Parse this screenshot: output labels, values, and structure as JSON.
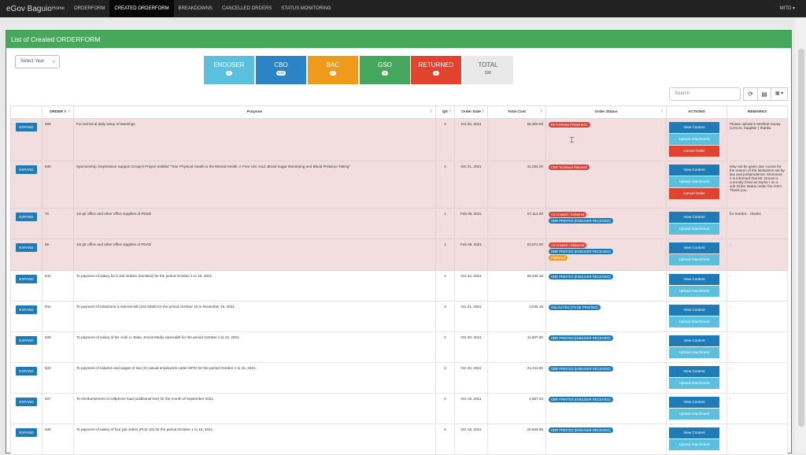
{
  "nav": {
    "brand": "eGov Baguio",
    "items": [
      "Home",
      "ORDERFORM",
      "CREATED ORDERFORM",
      "BREAKDOWNS",
      "CANCELLED ORDERS",
      "STATUS MONITORING"
    ],
    "user": "MITD ▾"
  },
  "panel": {
    "title": "List of Created ORDERFORM"
  },
  "year_select": "Select Year",
  "stats": {
    "enduser": {
      "label": "ENDUSER",
      "count": "0"
    },
    "cbo": {
      "label": "CBO",
      "count": "540"
    },
    "bac": {
      "label": "BAC",
      "count": "1"
    },
    "gso": {
      "label": "GSO",
      "count": "4"
    },
    "returned": {
      "label": "RETURNED",
      "count": "1"
    },
    "total": {
      "label": "TOTAL",
      "count": "596"
    }
  },
  "toolbar": {
    "search_placeholder": "Search",
    "refresh": "⟳",
    "list": "▤",
    "columns": "▦ ▾"
  },
  "table": {
    "headers": [
      "",
      "ORDER #",
      "Purpose",
      "Qtr",
      "Order Date",
      "Total Cost",
      "Order Status",
      "ACTIONS",
      "REMARKS"
    ],
    "expand_label": "EXPAND",
    "view_label": "View Content",
    "upload_label": "Upload Attachment",
    "cancel_label": "Cancel Order",
    "rows": [
      {
        "order": "599",
        "purpose": "For technical daily setup of Meetings",
        "qtr": "4",
        "date": "Oct 05, 2021",
        "cost": "66,300.00",
        "statuses": [
          {
            "text": "RETURNED FROM BAC",
            "color": "red"
          }
        ],
        "remarks": "Please upload 2 MARket Suvey (LOCAL Supplier ) thanks.",
        "cancel": true
      },
      {
        "order": "640",
        "purpose": "Sponsorship: Depression Support Group's Project entitled \"Your Physical Health is the Mental Health: A Free Uric Acid, Blood Sugar Monitoring and Blood Pressure Taking\"",
        "qtr": "4",
        "date": "Oct 21, 2021",
        "cost": "41,034.00",
        "statuses": [
          {
            "text": "CBO Technical Returned",
            "color": "red"
          }
        ],
        "remarks": "May not be given due course for the reason of the limitations set by law and jurisprudence. Moreover, it is informed that Mr. Ducas is currently hired as Nurse I on a Job Order status under the HSO. Thank you.",
        "cancel": true
      },
      {
        "order": "70",
        "purpose": "1st qtr office and other office supplies of PDSD",
        "qtr": "1",
        "date": "Feb 09, 2021",
        "cost": "67,114.00",
        "statuses": [
          {
            "text": "Air Created / Delivered",
            "color": "red"
          },
          {
            "text": "OBR PRINTED (ENDUSER RECEIVED)",
            "color": "blue"
          }
        ],
        "remarks": "for reorder... thanks",
        "cancel": false
      },
      {
        "order": "69",
        "purpose": "1st qtr office and other office supplies of PDAD",
        "qtr": "1",
        "date": "Feb 09, 2021",
        "cost": "23,071.00",
        "statuses": [
          {
            "text": "Air Created / Delivered",
            "color": "red"
          },
          {
            "text": "OBR PRINTED (ENDUSER RECEIVED)",
            "color": "blue"
          },
          {
            "text": "Published",
            "color": "orange"
          }
        ],
        "remarks": "-",
        "cancel": false
      },
      {
        "order": "642",
        "purpose": "To payment of salary for 6 Job Orders (SocMed) for the period October 1 to 15, 2021.",
        "qtr": "4",
        "date": "Oct 22, 2021",
        "cost": "69,230.16",
        "statuses": [
          {
            "text": "OBR PRINTED (ENDUSER RECEIVED)",
            "color": "blue"
          }
        ],
        "remarks": "-",
        "cancel": false
      },
      {
        "order": "641",
        "purpose": "To payment of telephone & internet bill (442-3939) for the period October 16 to November 15, 2021.",
        "qtr": "4",
        "date": "Oct 21, 2021",
        "cost": "3,045.18",
        "statuses": [
          {
            "text": "OBLIGATED (TO BE PRINTED)",
            "color": "blue"
          }
        ],
        "remarks": "-",
        "cancel": false
      },
      {
        "order": "639",
        "purpose": "To payment of salary of Mr. Ariel U. Biala, Social Media Specialist for the period October 1 to 15, 2021.",
        "qtr": "4",
        "date": "Oct 20, 2021",
        "cost": "11,507.90",
        "statuses": [
          {
            "text": "OBR PRINTED (ENDUSER RECEIVED)",
            "color": "blue"
          }
        ],
        "remarks": "-",
        "cancel": false
      },
      {
        "order": "633",
        "purpose": "To payment of salaries and wages of two (2) casual employees under MITD for the period October 1 to 15, 2021.",
        "qtr": "4",
        "date": "Oct 20, 2021",
        "cost": "21,611.00",
        "statuses": [
          {
            "text": "OBR PRINTED (ENDUSER RECEIVED)",
            "color": "blue"
          }
        ],
        "remarks": "-",
        "cancel": false
      },
      {
        "order": "637",
        "purpose": "To reimbursement of cellphone load (additional line) for the month of September 2021.",
        "qtr": "4",
        "date": "Oct 19, 2021",
        "cost": "2,897.24",
        "statuses": [
          {
            "text": "OBR PRINTED (ENDUSER RECEIVED)",
            "color": "blue"
          }
        ],
        "remarks": "-",
        "cancel": false
      },
      {
        "order": "636",
        "purpose": "To payment of salary of four job orders (PLD-JO) for the period October 1 to 15, 2021.",
        "qtr": "4",
        "date": "Oct 19, 2021",
        "cost": "29,609.96",
        "statuses": [
          {
            "text": "OBR PRINTED (ENDUSER RECEIVED)",
            "color": "blue"
          }
        ],
        "remarks": "-",
        "cancel": false
      }
    ]
  }
}
